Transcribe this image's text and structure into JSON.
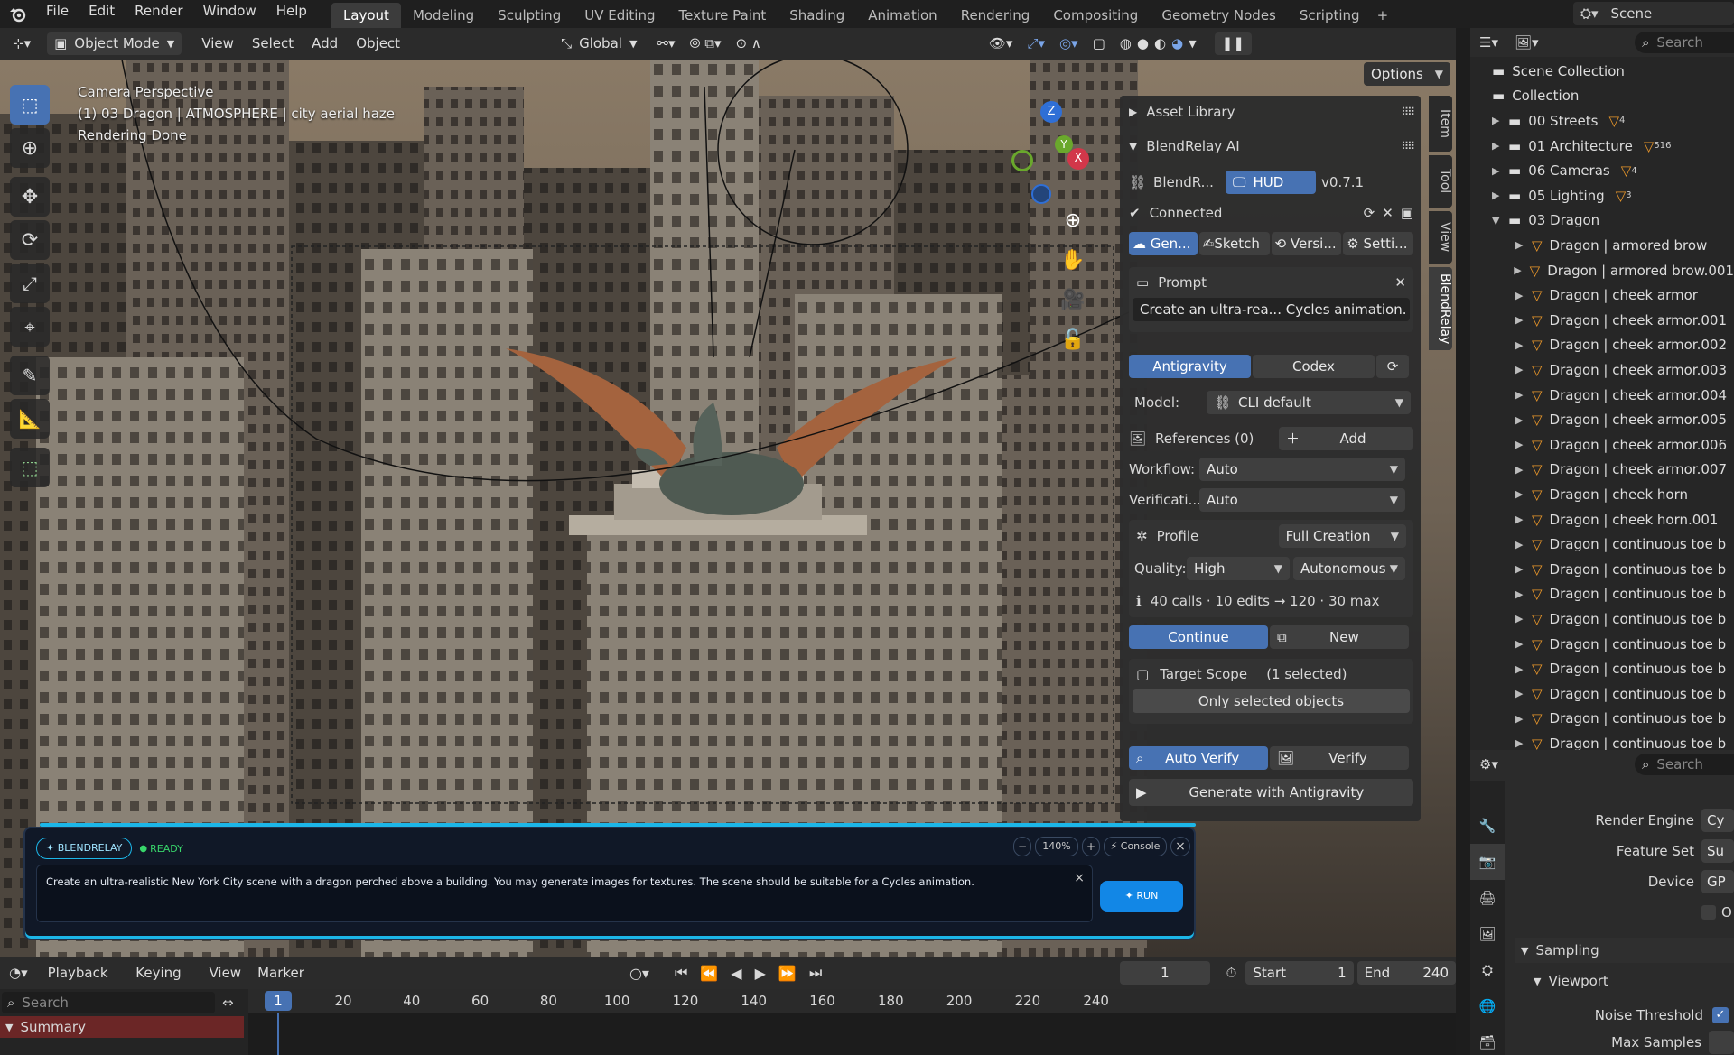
{
  "topbar": {
    "menus": [
      "File",
      "Edit",
      "Render",
      "Window",
      "Help"
    ],
    "workspaces": [
      "Layout",
      "Modeling",
      "Sculpting",
      "UV Editing",
      "Texture Paint",
      "Shading",
      "Animation",
      "Rendering",
      "Compositing",
      "Geometry Nodes",
      "Scripting"
    ],
    "active_workspace": "Layout",
    "plus": "+",
    "scene": "Scene"
  },
  "vp_header": {
    "mode": "Object Mode",
    "menus": [
      "View",
      "Select",
      "Add",
      "Object"
    ],
    "orientation": "Global",
    "options": "Options"
  },
  "overlay": {
    "line1": "Camera Perspective",
    "line2": "(1) 03 Dragon | ATMOSPHERE | city aerial haze",
    "line3": "Rendering Done"
  },
  "gizmo": {
    "z": "Z",
    "y": "Y",
    "x": "X"
  },
  "npanel": {
    "asset_library": "Asset Library",
    "addon_title": "BlendRelay AI",
    "blendr_label": "BlendR...",
    "hud_btn": "HUD",
    "version": "v0.7.1",
    "connected": "Connected",
    "tabs": [
      "Gen...",
      "Sketch",
      "Versi...",
      "Setti..."
    ],
    "prompt_label": "Prompt",
    "prompt_value": "Create an ultra-rea... Cycles animation.",
    "engines": [
      "Antigravity",
      "Codex"
    ],
    "model_label": "Model:",
    "model_value": "CLI default",
    "references_label": "References (0)",
    "add_label": "Add",
    "workflow_label": "Workflow:",
    "workflow_value": "Auto",
    "verification_label": "Verificati...",
    "verification_value": "Auto",
    "profile_label": "Profile",
    "profile_value": "Full Creation",
    "quality_label": "Quality:",
    "quality_value": "High",
    "autonomy_value": "Autonomous",
    "budget_info": "40 calls · 10 edits → 120 · 30 max",
    "continue_label": "Continue",
    "new_label": "New",
    "target_scope_label": "Target Scope",
    "target_scope_value": "(1 selected)",
    "only_selected": "Only selected objects",
    "auto_verify": "Auto Verify",
    "verify": "Verify",
    "generate": "Generate with Antigravity"
  },
  "sidetabs": [
    "Item",
    "Tool",
    "View",
    "BlendRelay"
  ],
  "hud": {
    "brand": "✦ BLENDRELAY",
    "status": "READY",
    "zoom": "140%",
    "minus": "−",
    "plus": "+",
    "console": "⚡ Console",
    "close": "×",
    "prompt_text": "Create an ultra-realistic New York City scene with a dragon perched above a building. You may generate images for textures. The scene should be suitable for a Cycles animation.",
    "clear": "×",
    "run": "✦ RUN"
  },
  "outliner": {
    "search_placeholder": "Search",
    "scene_collection": "Scene Collection",
    "collection": "Collection",
    "collections": [
      {
        "name": "00 Streets",
        "badge": "4"
      },
      {
        "name": "01 Architecture",
        "badge": "516"
      },
      {
        "name": "06 Cameras",
        "badge": "4"
      },
      {
        "name": "05 Lighting",
        "badge": "3"
      },
      {
        "name": "03 Dragon",
        "badge": ""
      }
    ],
    "dragon_children": [
      "Dragon | armored brow",
      "Dragon | armored brow.001",
      "Dragon | cheek armor",
      "Dragon | cheek armor.001",
      "Dragon | cheek armor.002",
      "Dragon | cheek armor.003",
      "Dragon | cheek armor.004",
      "Dragon | cheek armor.005",
      "Dragon | cheek armor.006",
      "Dragon | cheek armor.007",
      "Dragon | cheek horn",
      "Dragon | cheek horn.001",
      "Dragon | continuous toe b",
      "Dragon | continuous toe b",
      "Dragon | continuous toe b",
      "Dragon | continuous toe b",
      "Dragon | continuous toe b",
      "Dragon | continuous toe b",
      "Dragon | continuous toe b",
      "Dragon | continuous toe b",
      "Dragon | continuous toe b"
    ]
  },
  "props": {
    "search_placeholder": "Search",
    "render_engine_label": "Render Engine",
    "render_engine_value": "Cy",
    "feature_set_label": "Feature Set",
    "feature_set_value": "Su",
    "device_label": "Device",
    "device_value": "GP",
    "checkbox_label": "O",
    "sampling": "Sampling",
    "viewport": "Viewport",
    "noise_threshold": "Noise Threshold",
    "max_samples": "Max Samples"
  },
  "timeline": {
    "menus": [
      "Playback",
      "Keying",
      "View",
      "Marker"
    ],
    "current_frame": "1",
    "start_label": "Start",
    "start_value": "1",
    "end_label": "End",
    "end_value": "240",
    "search_placeholder": "Search",
    "summary": "Summary",
    "ticks": [
      "1",
      "20",
      "40",
      "60",
      "80",
      "100",
      "120",
      "140",
      "160",
      "180",
      "200",
      "220",
      "240"
    ]
  },
  "colors": {
    "accent_blue": "#4772b3",
    "hud_cyan": "#1cb6e8",
    "ready_green": "#38d66b",
    "outliner_orange": "#e8962a",
    "summary_red": "#6b2626"
  }
}
